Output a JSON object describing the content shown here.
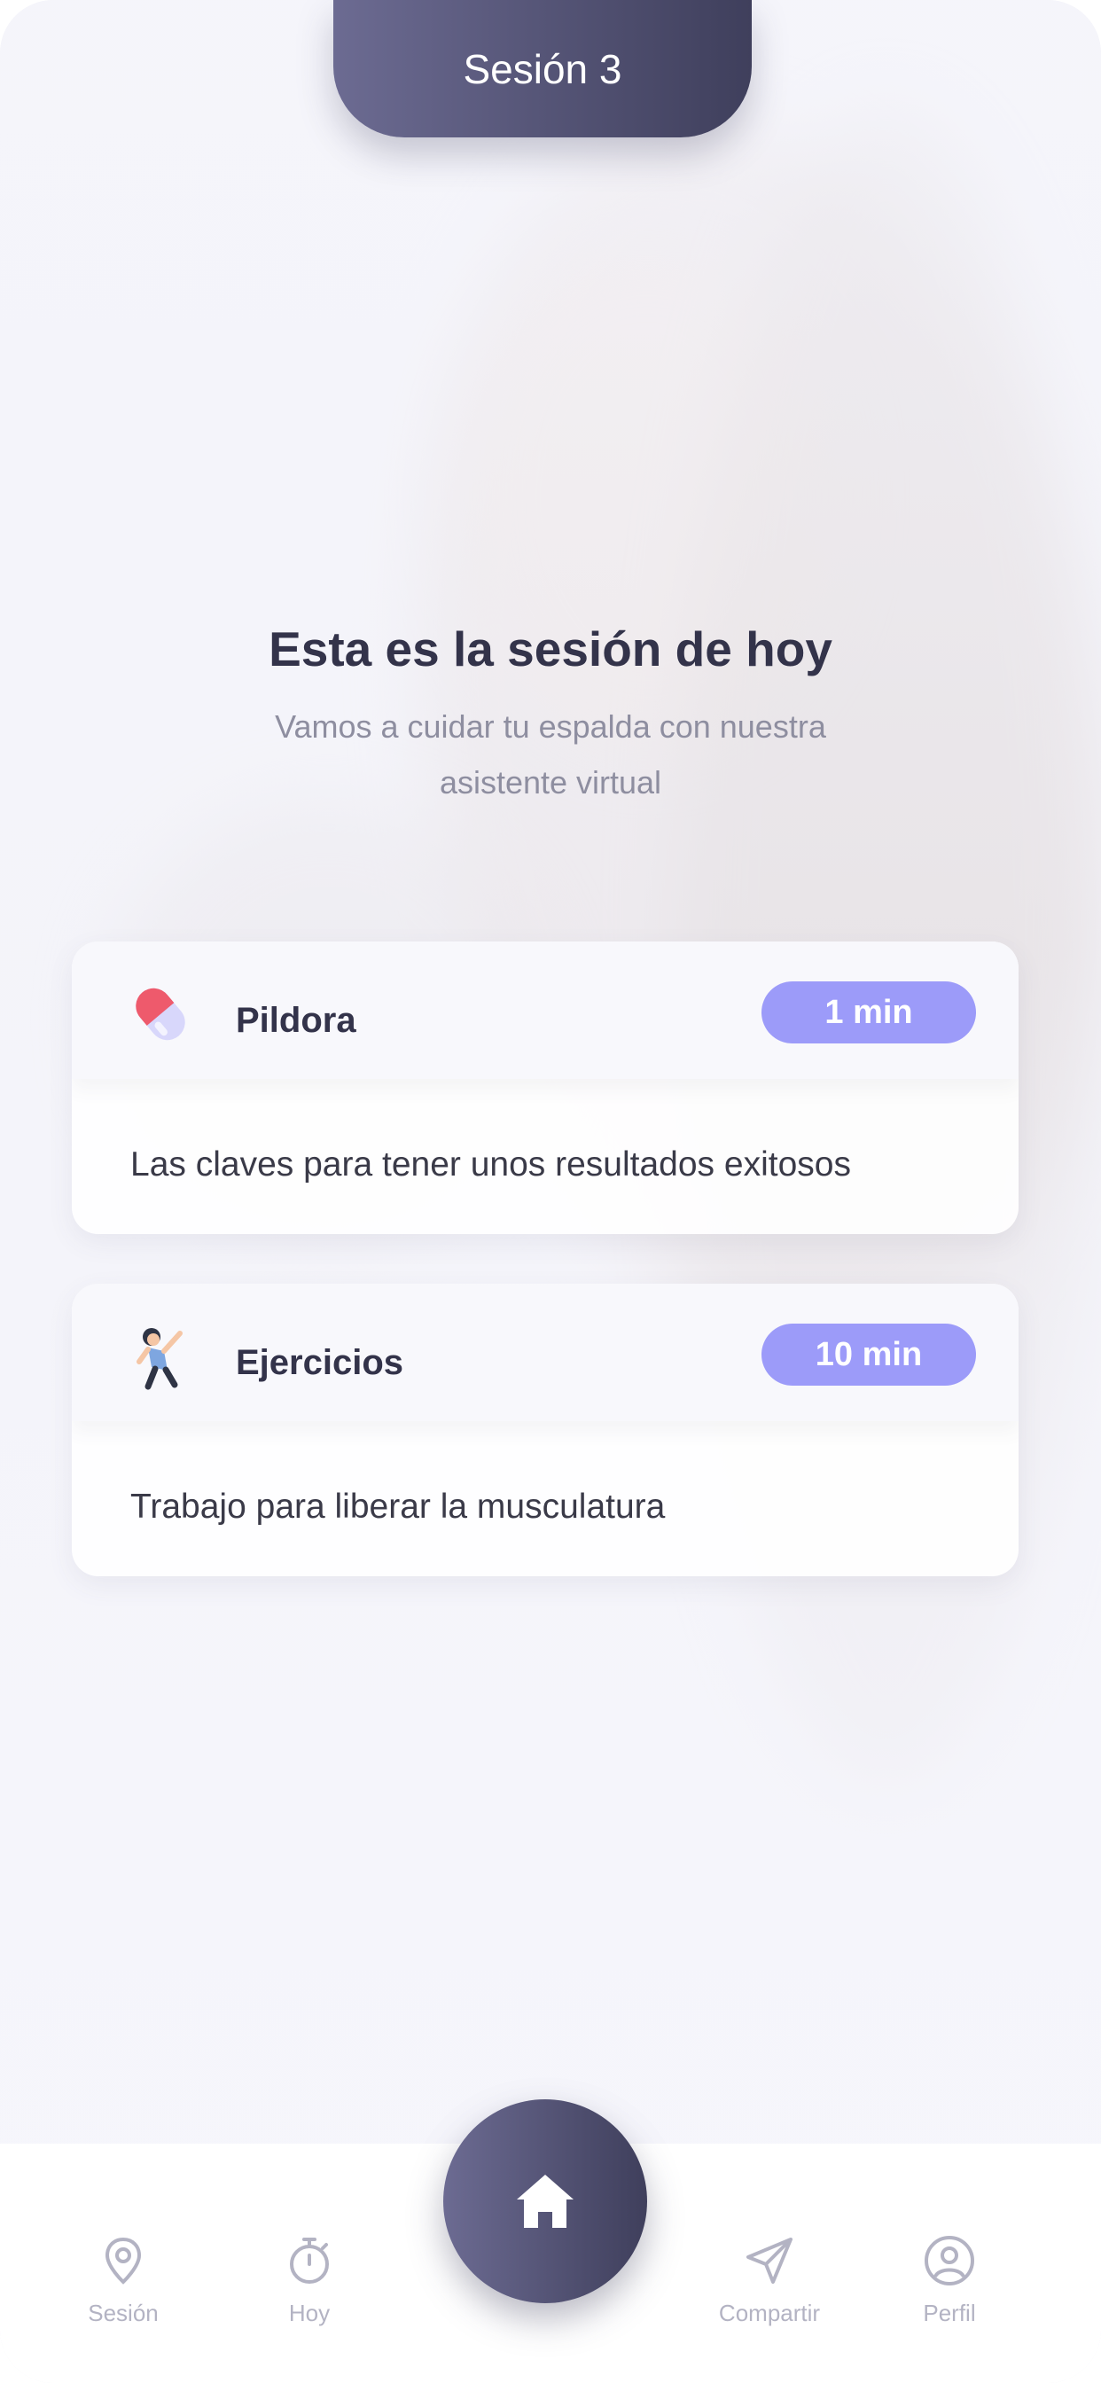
{
  "header": {
    "session_label": "Sesión 3"
  },
  "intro": {
    "title": "Esta es la sesión de hoy",
    "subtitle_line1": "Vamos a cuidar tu espalda con nuestra",
    "subtitle_line2": "asistente virtual"
  },
  "cards": [
    {
      "title": "Pildora",
      "duration": "1 min",
      "description": "Las claves para tener unos resultados exitosos",
      "icon": "pill-icon"
    },
    {
      "title": "Ejercicios",
      "duration": "10 min",
      "description": "Trabajo para liberar la musculatura",
      "icon": "exercise-icon"
    }
  ],
  "tabbar": {
    "items": [
      {
        "label": "Sesión",
        "icon": "location-pin-icon"
      },
      {
        "label": "Hoy",
        "icon": "stopwatch-icon"
      },
      {
        "label": "Compartir",
        "icon": "send-icon"
      },
      {
        "label": "Perfil",
        "icon": "user-circle-icon"
      }
    ],
    "home_icon": "home-icon"
  },
  "colors": {
    "accent": "#9c9bf9",
    "primary_dark": "#3f3f5c",
    "text_dark": "#33334a",
    "text_muted": "#8e8ea0",
    "tab_inactive": "#b3b3c3"
  }
}
